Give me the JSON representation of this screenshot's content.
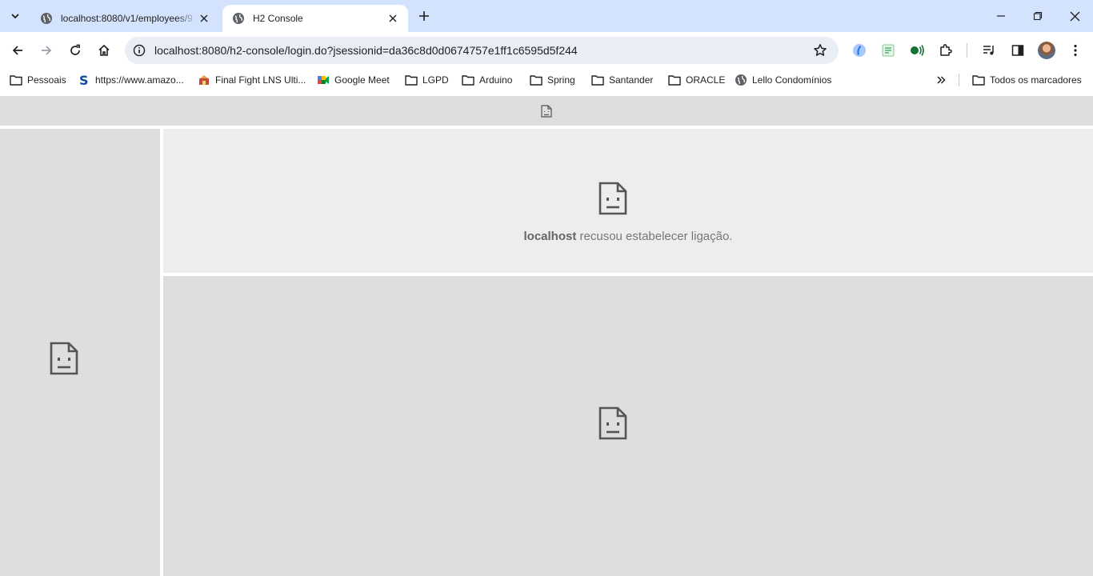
{
  "tabs": [
    {
      "title": "localhost:8080/v1/employees/9",
      "active": false
    },
    {
      "title": "H2 Console",
      "active": true
    }
  ],
  "toolbar": {
    "url": "localhost:8080/h2-console/login.do?jsessionid=da36c8d0d0674757e1ff1c6595d5f244"
  },
  "bookmarks": [
    {
      "label": "Pessoais",
      "icon": "folder-icon"
    },
    {
      "label": "https://www.amazo...",
      "icon": "s-logo-icon"
    },
    {
      "label": "Final Fight LNS Ulti...",
      "icon": "game-favicon"
    },
    {
      "label": "Google Meet",
      "icon": "google-meet-icon"
    },
    {
      "label": "LGPD",
      "icon": "folder-icon"
    },
    {
      "label": "Arduino",
      "icon": "folder-icon"
    },
    {
      "label": "Spring",
      "icon": "folder-icon"
    },
    {
      "label": "Santander",
      "icon": "folder-icon"
    },
    {
      "label": "ORACLE",
      "icon": "folder-icon"
    },
    {
      "label": "Lello Condomínios",
      "icon": "globe-icon"
    }
  ],
  "all_bookmarks_label": "Todos os marcadores",
  "error": {
    "host": "localhost",
    "message": " recusou estabelecer ligação."
  },
  "colors": {
    "tabstrip": "#d3e3fd",
    "omnibox": "#e9eef6",
    "frame_bg": "#dedede",
    "error_frame_bg": "#ededed"
  }
}
